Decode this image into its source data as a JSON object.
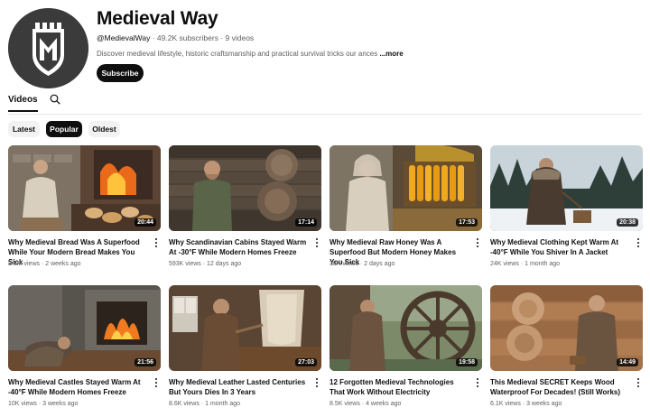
{
  "channel": {
    "name": "Medieval Way",
    "handle": "@MedievalWay",
    "subscribers": "49.2K subscribers",
    "video_count": "9 videos",
    "separator": " · ",
    "description": "Discover medieval lifestyle, historic craftsmanship and practical survival tricks our ances",
    "more_label": "...more",
    "subscribe_label": "Subscribe"
  },
  "tabs": {
    "videos_label": "Videos"
  },
  "filters": [
    {
      "label": "Latest",
      "selected": false
    },
    {
      "label": "Popular",
      "selected": true
    },
    {
      "label": "Oldest",
      "selected": false
    }
  ],
  "videos": [
    {
      "title": "Why Medieval Bread Was A Superfood While Your Modern Bread Makes You Sick",
      "views": "2.1M views",
      "age": "2 weeks ago",
      "duration": "20:44"
    },
    {
      "title": "Why Scandinavian Cabins Stayed Warm At -30°F While Modern Homes Freeze",
      "views": "593K views",
      "age": "12 days ago",
      "duration": "17:14"
    },
    {
      "title": "Why Medieval Raw Honey Was A Superfood But Modern Honey Makes You Sick",
      "views": "38K views",
      "age": "2 days ago",
      "duration": "17:53"
    },
    {
      "title": "Why Medieval Clothing Kept Warm At -40°F While You Shiver In A Jacket",
      "views": "24K views",
      "age": "1 month ago",
      "duration": "20:38"
    },
    {
      "title": "Why Medieval Castles Stayed Warm At -40°F While Modern Homes Freeze",
      "views": "10K views",
      "age": "3 weeks ago",
      "duration": "21:56"
    },
    {
      "title": "Why Medieval Leather Lasted Centuries But Yours Dies In 3 Years",
      "views": "8.6K views",
      "age": "1 month ago",
      "duration": "27:03"
    },
    {
      "title": "12 Forgotten Medieval Technologies That Work Without Electricity",
      "views": "8.5K views",
      "age": "4 weeks ago",
      "duration": "19:58"
    },
    {
      "title": "This Medieval SECRET Keeps Wood Waterproof For Decades! (Still Works)",
      "views": "6.1K views",
      "age": "3 weeks ago",
      "duration": "14:49"
    }
  ],
  "colors": {
    "text": "#0f0f0f",
    "secondary": "#606060",
    "chip_bg": "#f2f2f2"
  }
}
